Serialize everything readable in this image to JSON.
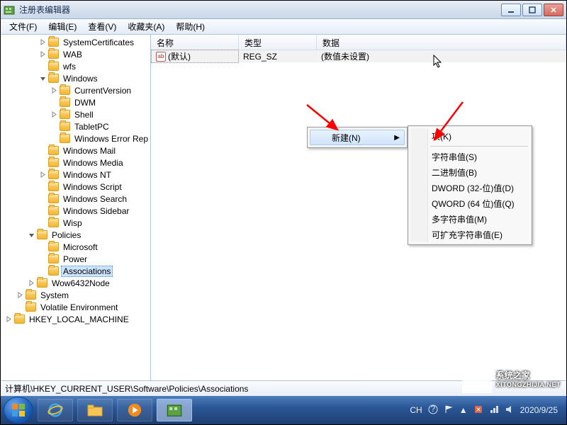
{
  "window": {
    "title": "注册表编辑器"
  },
  "menubar": [
    {
      "label": "文件(F)"
    },
    {
      "label": "编辑(E)"
    },
    {
      "label": "查看(V)"
    },
    {
      "label": "收藏夹(A)"
    },
    {
      "label": "帮助(H)"
    }
  ],
  "tree": [
    {
      "depth": 2,
      "toggle": "closed",
      "label": "SystemCertificates"
    },
    {
      "depth": 2,
      "toggle": "closed",
      "label": "WAB"
    },
    {
      "depth": 2,
      "toggle": "none",
      "label": "wfs"
    },
    {
      "depth": 2,
      "toggle": "open",
      "label": "Windows"
    },
    {
      "depth": 3,
      "toggle": "closed",
      "label": "CurrentVersion"
    },
    {
      "depth": 3,
      "toggle": "none",
      "label": "DWM"
    },
    {
      "depth": 3,
      "toggle": "closed",
      "label": "Shell"
    },
    {
      "depth": 3,
      "toggle": "none",
      "label": "TabletPC"
    },
    {
      "depth": 3,
      "toggle": "none",
      "label": "Windows Error Rep"
    },
    {
      "depth": 2,
      "toggle": "none",
      "label": "Windows Mail"
    },
    {
      "depth": 2,
      "toggle": "none",
      "label": "Windows Media"
    },
    {
      "depth": 2,
      "toggle": "closed",
      "label": "Windows NT"
    },
    {
      "depth": 2,
      "toggle": "none",
      "label": "Windows Script"
    },
    {
      "depth": 2,
      "toggle": "none",
      "label": "Windows Search"
    },
    {
      "depth": 2,
      "toggle": "none",
      "label": "Windows Sidebar"
    },
    {
      "depth": 2,
      "toggle": "none",
      "label": "Wisp"
    },
    {
      "depth": 1,
      "toggle": "open",
      "label": "Policies"
    },
    {
      "depth": 2,
      "toggle": "none",
      "label": "Microsoft"
    },
    {
      "depth": 2,
      "toggle": "none",
      "label": "Power"
    },
    {
      "depth": 2,
      "toggle": "none",
      "label": "Associations",
      "selected": true
    },
    {
      "depth": 1,
      "toggle": "closed",
      "label": "Wow6432Node"
    },
    {
      "depth": 0,
      "toggle": "closed",
      "label": "System"
    },
    {
      "depth": 0,
      "toggle": "none",
      "label": "Volatile Environment"
    },
    {
      "depth": -1,
      "toggle": "closed",
      "label": "HKEY_LOCAL_MACHINE"
    }
  ],
  "list": {
    "columns": {
      "name": "名称",
      "type": "类型",
      "data": "数据"
    },
    "rows": [
      {
        "icon": "ab",
        "name": "(默认)",
        "type": "REG_SZ",
        "data": "(数值未设置)",
        "selected": true
      }
    ]
  },
  "context_menu_1": {
    "items": [
      {
        "label": "新建(N)",
        "has_submenu": true,
        "highlight": true
      }
    ]
  },
  "context_menu_2": {
    "items": [
      {
        "label": "项(K)"
      },
      {
        "sep": true
      },
      {
        "label": "字符串值(S)"
      },
      {
        "label": "二进制值(B)"
      },
      {
        "label": "DWORD (32-位)值(D)"
      },
      {
        "label": "QWORD (64 位)值(Q)"
      },
      {
        "label": "多字符串值(M)"
      },
      {
        "label": "可扩充字符串值(E)"
      }
    ]
  },
  "statusbar": {
    "path": "计算机\\HKEY_CURRENT_USER\\Software\\Policies\\Associations"
  },
  "tray": {
    "ime": "CH",
    "date": "2020/9/25"
  },
  "watermark": {
    "text": "系统之家",
    "url": "XITONGZHIJIA.NET"
  }
}
